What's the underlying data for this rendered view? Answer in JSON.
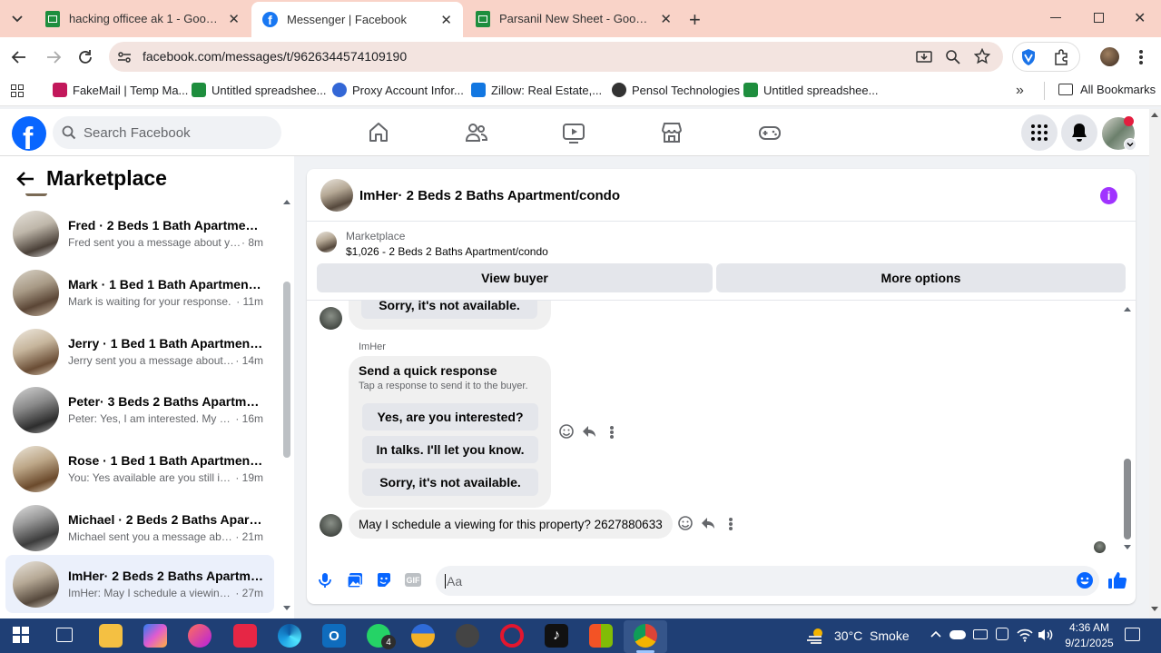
{
  "browser": {
    "tabs": [
      {
        "title": "hacking officee ak 1 - Google Sh",
        "icon": "sheets-icon",
        "active": false
      },
      {
        "title": "Messenger | Facebook",
        "icon": "facebook-icon",
        "active": true
      },
      {
        "title": "Parsanil New Sheet - Google Sh",
        "icon": "sheets-icon",
        "active": false
      }
    ],
    "url": "facebook.com/messages/t/9626344574109190",
    "bookmarks": [
      {
        "label": "FakeMail | Temp Ma...",
        "color": "#c2185b"
      },
      {
        "label": "Untitled spreadshee...",
        "color": "#1e8e3e"
      },
      {
        "label": "Proxy Account Infor...",
        "color": "#3367d6"
      },
      {
        "label": "Zillow: Real Estate,...",
        "color": "#1277e1"
      },
      {
        "label": "Pensol Technologies",
        "color": "#333333"
      },
      {
        "label": "Untitled spreadshee...",
        "color": "#1e8e3e"
      }
    ],
    "all_bookmarks": "All Bookmarks"
  },
  "facebook": {
    "search_placeholder": "Search Facebook",
    "sidebar_title": "Marketplace",
    "conversations": [
      {
        "name": "Fred · 2 Beds 1 Bath Apartment/...",
        "snippet": "Fred sent you a message about yo...",
        "time": "· 8m",
        "active": false
      },
      {
        "name": "Mark · 1 Bed 1 Bath Apartment/...",
        "snippet": "Mark is waiting for your response.",
        "time": "· 11m",
        "active": false
      },
      {
        "name": "Jerry · 1 Bed 1 Bath Apartment/c...",
        "snippet": "Jerry sent you a message about y...",
        "time": "· 14m",
        "active": false
      },
      {
        "name": "Peter· 3 Beds 2 Baths Apartmen...",
        "snippet": "Peter: Yes, I am interested. My nu...",
        "time": "· 16m",
        "active": false
      },
      {
        "name": "Rose · 1 Bed 1 Bath Apartment/c...",
        "snippet": "You: Yes available are you still int...",
        "time": "· 19m",
        "active": false
      },
      {
        "name": "Michael · 2 Beds 2 Baths Apart...",
        "snippet": "Michael sent you a message abo...",
        "time": "· 21m",
        "active": false
      },
      {
        "name": "ImHer· 2 Beds 2 Baths Apartme...",
        "snippet": "ImHer: May I schedule a viewing ...",
        "time": "· 27m",
        "active": true
      }
    ],
    "chat": {
      "title": "ImHer· 2 Beds 2 Baths Apartment/condo",
      "listing_label": "Marketplace",
      "listing_price_title": "$1,026 - 2 Beds 2 Baths Apartment/condo",
      "view_buyer": "View buyer",
      "more_options": "More options",
      "prev_option": "Sorry, it's not available.",
      "sender_name": "ImHer",
      "quick_title": "Send a quick response",
      "quick_subtitle": "Tap a response to send it to the buyer.",
      "quick_options": [
        "Yes, are you interested?",
        "In talks. I'll let you know.",
        "Sorry, it's not available."
      ],
      "last_message": "May I schedule a viewing for this property? 2627880633",
      "input_placeholder": "Aa"
    }
  },
  "taskbar": {
    "weather": "30°C  Smoke",
    "time": "4:36 AM",
    "date": "9/21/2025",
    "whatsapp_badge": "4"
  }
}
